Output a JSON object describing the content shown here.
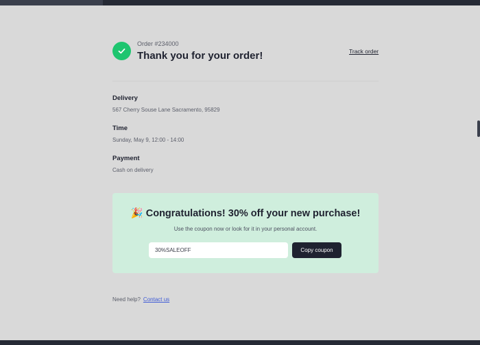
{
  "order": {
    "number": "Order #234000",
    "title": "Thank you for your order!",
    "track_label": "Track order"
  },
  "details": [
    {
      "label": "Delivery",
      "value": "567 Cherry Souse Lane Sacramento, 95829"
    },
    {
      "label": "Time",
      "value": "Sunday, May 9, 12:00 - 14:00"
    },
    {
      "label": "Payment",
      "value": "Cash on delivery"
    }
  ],
  "promo": {
    "emoji": "🎉",
    "title": "Congratulations! 30% off your new purchase!",
    "subtitle": "Use the coupon now or look for it in your personal account.",
    "coupon_code": "30%SALEOFF",
    "copy_label": "Copy coupon"
  },
  "help": {
    "text": "Need help?",
    "link_label": "Contact us"
  },
  "icons": {
    "success": "check-circle-icon",
    "celebrate": "party-popper-icon"
  },
  "colors": {
    "success": "#1ec56f",
    "promo_bg": "#cfeedd",
    "button_bg": "#1f2230",
    "link": "#3f5bd6"
  }
}
